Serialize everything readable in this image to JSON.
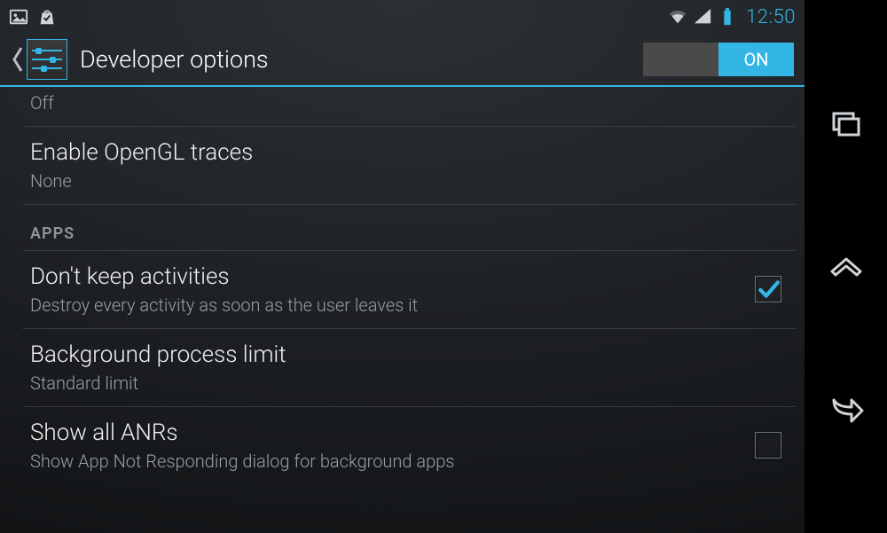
{
  "status": {
    "time": "12:50"
  },
  "action_bar": {
    "title": "Developer options",
    "switch_on_label": "ON",
    "switch_state": true
  },
  "rows": {
    "prev_sub": "Off",
    "opengl": {
      "title": "Enable OpenGL traces",
      "sub": "None"
    },
    "section_apps": "Apps",
    "dont_keep": {
      "title": "Don't keep activities",
      "sub": "Destroy every activity as soon as the user leaves it",
      "checked": true
    },
    "bg_limit": {
      "title": "Background process limit",
      "sub": "Standard limit"
    },
    "show_anrs": {
      "title": "Show all ANRs",
      "sub": "Show App Not Responding dialog for background apps",
      "checked": false
    }
  }
}
